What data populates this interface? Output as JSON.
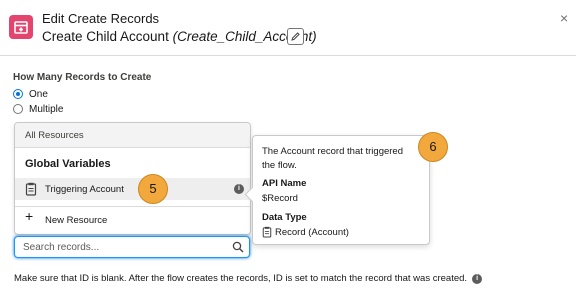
{
  "header": {
    "title": "Edit Create Records",
    "subtitle_name": "Create Child Account",
    "subtitle_api": "(Create_Child_Account)",
    "close_glyph": "×",
    "icon": "create-records-icon",
    "icon_color": "#e3456f"
  },
  "records_section": {
    "label": "How Many Records to Create",
    "options": [
      {
        "label": "One",
        "selected": true
      },
      {
        "label": "Multiple",
        "selected": false
      }
    ]
  },
  "resource_picker": {
    "header": "All Resources",
    "group_label": "Global Variables",
    "selected_item": "Triggering Account",
    "new_resource": "New Resource",
    "info_glyph": "i"
  },
  "search": {
    "placeholder": "Search records...",
    "value": ""
  },
  "tooltip": {
    "description": "The Account record that triggered the flow.",
    "api_name_label": "API Name",
    "api_name_value": "$Record",
    "data_type_label": "Data Type",
    "data_type_value": "Record (Account)"
  },
  "callouts": [
    "5",
    "6"
  ],
  "footer": {
    "text": "Make sure that ID is blank. After the flow creates the records, ID is set to match the record that was created.",
    "info_glyph": "i"
  },
  "colors": {
    "accent": "#0176d3",
    "callout": "#f2a83c"
  }
}
